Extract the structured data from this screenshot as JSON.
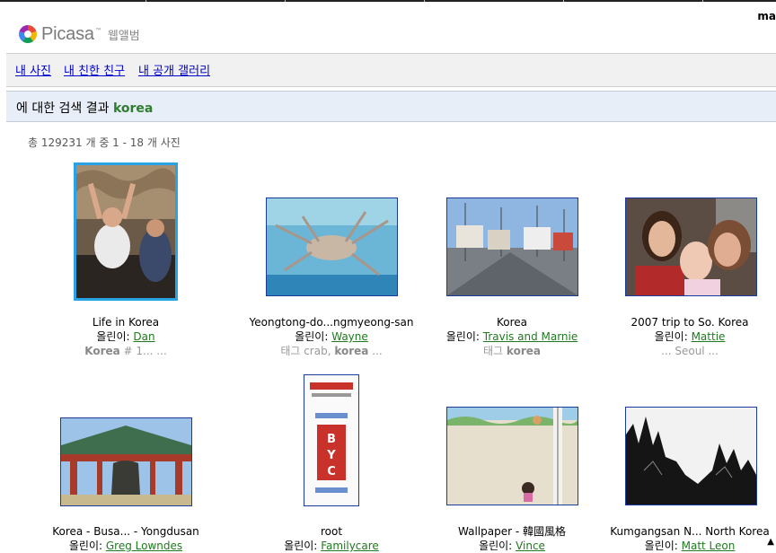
{
  "header": {
    "brand": "Picasa",
    "tm": "™",
    "subtitle": "웹앨범",
    "user": "ma"
  },
  "nav": {
    "my_photos": "내 사진",
    "my_friends": "내 친한 친구",
    "public_gallery": "내 공개 갤러리"
  },
  "results": {
    "title_prefix": "에 대한 검색 결과",
    "query": "korea",
    "count": "총 129231 개 중 1 - 18 개 사진"
  },
  "by_label": "올린이:",
  "photos": [
    {
      "title": "Life in Korea",
      "author": "Dan",
      "meta": "Korea # 1... ..."
    },
    {
      "title": "Yeongtong-do...ngmyeong-san",
      "author": "Wayne",
      "meta": "태그 crab, korea ..."
    },
    {
      "title": "Korea",
      "author": "Travis and Marnie",
      "meta": "태그 korea"
    },
    {
      "title": "2007 trip to So. Korea",
      "author": "Mattie",
      "meta": "... Seoul ..."
    },
    {
      "title": "Korea - Busa... - Yongdusan",
      "author": "Greg Lowndes"
    },
    {
      "title": "root",
      "author": "Familycare"
    },
    {
      "title": "Wallpaper - 韓國風格",
      "author": "Vince"
    },
    {
      "title": "Kumgangsan N... North Korea",
      "author": "Matt Leon"
    }
  ]
}
